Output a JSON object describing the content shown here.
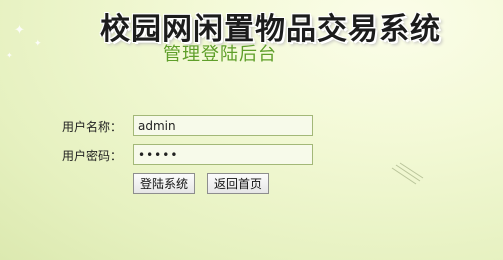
{
  "header": {
    "title": "校园网闲置物品交易系统",
    "subtitle": "管理登陆后台"
  },
  "login_form": {
    "username": {
      "label": "用户名称：",
      "value": "admin"
    },
    "password": {
      "label": "用户密码：",
      "value": "admin"
    },
    "submit_label": "登陆系统",
    "back_label": "返回首页"
  },
  "theme": {
    "background": "#eef6cf",
    "subtitle_color": "#5f9f2a",
    "input_border": "#a3b878"
  }
}
